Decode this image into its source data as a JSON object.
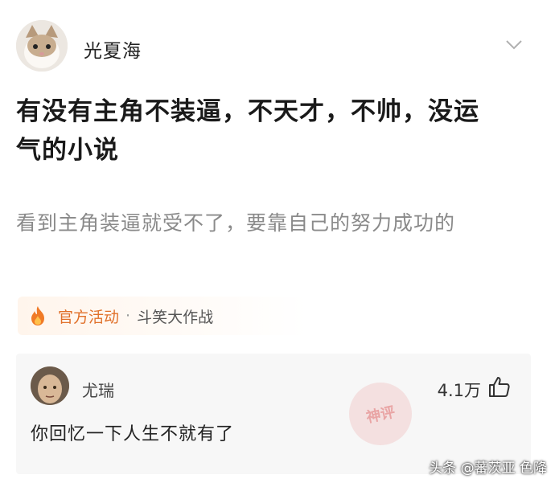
{
  "post": {
    "author": "光夏海",
    "title_line1": "有没有主角不装逼，不天才，不帅，没运",
    "title_line2": "气的小说",
    "description": "看到主角装逼就受不了，要靠自己的努力成功的"
  },
  "activity": {
    "label": "官方活动",
    "separator": "·",
    "name": "斗笑大作战",
    "accent_color": "#e0702a"
  },
  "comment": {
    "author": "尤瑞",
    "likes": "4.1万",
    "text": "你回忆一下人生不就有了",
    "stamp_text": "神评"
  },
  "watermark": "头条 @蕃茨亚 色降",
  "icons": {
    "chevron": "chevron-down-icon",
    "fire": "fire-icon",
    "like": "thumbs-up-icon"
  }
}
